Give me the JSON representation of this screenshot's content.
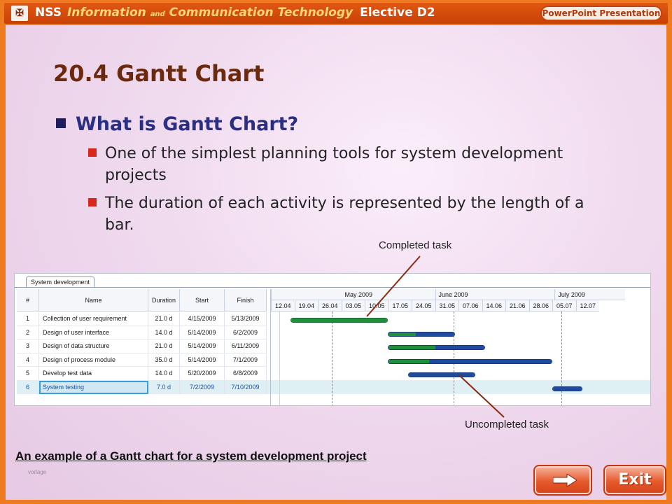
{
  "header": {
    "logo_glyph": "✠",
    "title_nss": "NSS",
    "title_ict": "Information",
    "title_and": "and",
    "title_ict2": "Communication Technology",
    "title_elective": "Elective D2",
    "badge": "PowerPoint Presentation"
  },
  "slide": {
    "heading": "20.4 Gantt Chart",
    "bullet": "What is Gantt Chart?",
    "sub_bullets": [
      "One of the simplest planning tools for system development projects",
      "The duration of each activity is represented by the length of a bar."
    ],
    "callout_completed": "Completed task",
    "callout_uncompleted": "Uncompleted task",
    "caption": "An example of a Gantt chart for a system development project",
    "watermark": "vorlage"
  },
  "gantt": {
    "tab": "System development",
    "columns": [
      "#",
      "Name",
      "Duration",
      "Start",
      "Finish"
    ],
    "rows": [
      {
        "num": "1",
        "name": "Collection of user requirement",
        "duration": "21.0 d",
        "start": "4/15/2009",
        "finish": "5/13/2009",
        "done_fraction": 1.0
      },
      {
        "num": "2",
        "name": "Design of user interface",
        "duration": "14.0 d",
        "start": "5/14/2009",
        "finish": "6/2/2009",
        "done_fraction": 0.42
      },
      {
        "num": "3",
        "name": "Design of data structure",
        "duration": "21.0 d",
        "start": "5/14/2009",
        "finish": "6/11/2009",
        "done_fraction": 0.49
      },
      {
        "num": "4",
        "name": "Design of process module",
        "duration": "35.0 d",
        "start": "5/14/2009",
        "finish": "7/1/2009",
        "done_fraction": 0.25
      },
      {
        "num": "5",
        "name": "Develop test data",
        "duration": "14.0 d",
        "start": "5/20/2009",
        "finish": "6/8/2009",
        "done_fraction": 0.0
      },
      {
        "num": "6",
        "name": "System testing",
        "duration": "7.0 d",
        "start": "7/2/2009",
        "finish": "7/10/2009",
        "done_fraction": 0.0
      }
    ],
    "months": [
      "May 2009",
      "June 2009",
      "July 2009"
    ],
    "weeks": [
      "12.04",
      "19.04",
      "26.04",
      "03.05",
      "10.05",
      "17.05",
      "24.05",
      "31.05",
      "07.06",
      "14.06",
      "21.06",
      "28.06",
      "05.07",
      "12.07"
    ],
    "colors": {
      "completed": "#1f8f3e",
      "uncompleted": "#1e4aa0"
    }
  },
  "nav": {
    "next_icon": "right-arrow-icon",
    "exit_label": "Exit"
  }
}
